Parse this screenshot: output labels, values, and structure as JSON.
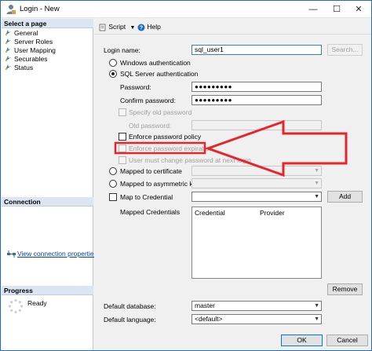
{
  "window": {
    "title": "Login - New",
    "controls": {
      "minimize": "—",
      "maximize": "☐",
      "close": "✕"
    }
  },
  "left_pane": {
    "select_page_header": "Select a page",
    "pages": [
      {
        "label": "General",
        "icon": "page-icon"
      },
      {
        "label": "Server Roles",
        "icon": "page-icon"
      },
      {
        "label": "User Mapping",
        "icon": "page-icon"
      },
      {
        "label": "Securables",
        "icon": "page-icon"
      },
      {
        "label": "Status",
        "icon": "page-icon"
      }
    ],
    "connection_header": "Connection",
    "view_connection_properties": "View connection properties",
    "progress_header": "Progress",
    "progress_status": "Ready"
  },
  "toolbar": {
    "script_label": "Script",
    "help_label": "Help"
  },
  "form": {
    "login_name_label": "Login name:",
    "login_name_value": "sql_user1",
    "search_button": "Search...",
    "windows_auth_label": "Windows authentication",
    "sql_auth_label": "SQL Server authentication",
    "password_label": "Password:",
    "password_value": "●●●●●●●●●",
    "confirm_password_label": "Confirm password:",
    "confirm_password_value": "●●●●●●●●●",
    "specify_old_password_label": "Specify old password",
    "old_password_label": "Old password:",
    "enforce_policy_label": "Enforce password policy",
    "enforce_expiration_label": "Enforce password expiration",
    "must_change_label": "User must change password at next login",
    "mapped_to_certificate_label": "Mapped to certificate",
    "mapped_to_asymmetric_key_label": "Mapped to asymmetric key",
    "map_to_credential_label": "Map to Credential",
    "add_button": "Add",
    "mapped_credentials_label": "Mapped Credentials",
    "credentials_columns": [
      "Credential",
      "Provider"
    ],
    "remove_button": "Remove",
    "default_database_label": "Default database:",
    "default_database_value": "master",
    "default_language_label": "Default language:",
    "default_language_value": "<default>"
  },
  "footer": {
    "ok_button": "OK",
    "cancel_button": "Cancel"
  },
  "annotation": {
    "color": "#e8242b"
  }
}
